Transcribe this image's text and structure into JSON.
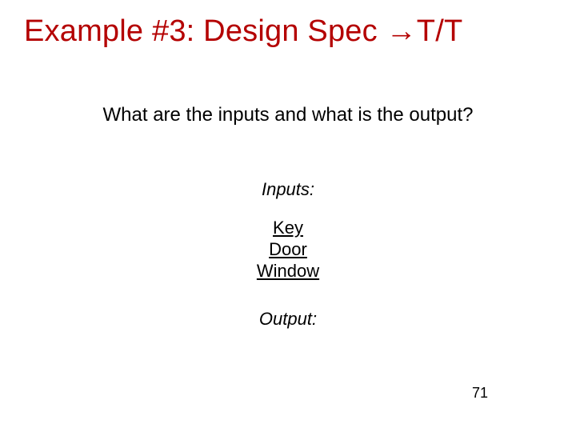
{
  "title": "Example #3: Design Spec →T/T",
  "question": "What are the inputs and what is the output?",
  "inputs_label": "Inputs:",
  "inputs": [
    "Key",
    "Door",
    "Window"
  ],
  "output_label": "Output:",
  "page_number": "71"
}
